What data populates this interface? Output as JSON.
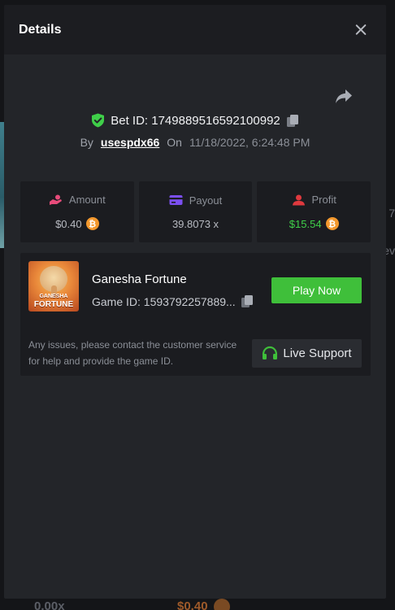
{
  "modal": {
    "title": "Details"
  },
  "bet": {
    "id_label": "Bet ID: 1749889516592100992",
    "by_label": "By",
    "username": "usespdx66",
    "on_label": "On",
    "datetime": "11/18/2022, 6:24:48 PM"
  },
  "stats": {
    "amount": {
      "label": "Amount",
      "value": "$0.40",
      "icon": "hand-coins-icon"
    },
    "payout": {
      "label": "Payout",
      "value": "39.8073 x",
      "icon": "card-icon"
    },
    "profit": {
      "label": "Profit",
      "value": "$15.54",
      "icon": "user-profit-icon"
    }
  },
  "game": {
    "title": "Ganesha Fortune",
    "id_label": "Game ID: 1593792257889...",
    "thumb_text_small": "GANESHA",
    "thumb_text_big": "FORTUNE",
    "play_label": "Play Now"
  },
  "support": {
    "message": "Any issues, please contact the customer service for help and provide the game ID.",
    "button_label": "Live Support"
  },
  "background": {
    "bottom_left": "0.00x",
    "bottom_center": "$0.40",
    "right_1": "7",
    "right_2": "ev"
  },
  "colors": {
    "accent_green": "#3fbf3a",
    "profit_green": "#3fcf49",
    "btc_orange": "#f3982d",
    "amount_pink": "#e84b7a",
    "payout_purple": "#7b4ff0",
    "profit_red": "#e0393e"
  }
}
